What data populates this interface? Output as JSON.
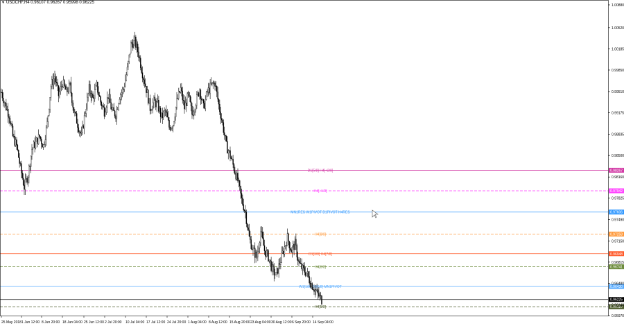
{
  "header": {
    "symbol_label": "USDCHF,H4",
    "ohlc_label": "0.96107 0.96267 0.95998 0.96225",
    "menu_icon": "triangle-down-icon"
  },
  "colors": {
    "background": "#ffffff",
    "axis": "#000000",
    "candle": "#000000"
  },
  "chart_data": {
    "type": "candlestick",
    "title": "",
    "xlabel": "",
    "ylabel": "",
    "ylim": [
      0.9597,
      1.0088
    ],
    "y_ticks": [
      "1.00880",
      "1.00520",
      "1.00185",
      "0.99850",
      "0.99510",
      "0.99175",
      "0.98835",
      "0.98500",
      "0.98160",
      "0.97825",
      "0.97490",
      "0.97150",
      "0.96815",
      "0.96480",
      "0.96140",
      "0.95970"
    ],
    "x_ticks": [
      "25 May 2018",
      "1 Jun 12:00",
      "8 Jun 20:00",
      "18 Jun 04:00",
      "25 Jun 12:00",
      "2 Jul 20:00",
      "10 Jul 04:00",
      "17 Jul 12:00",
      "24 Jul 20:00",
      "1 Aug 04:00",
      "8 Aug 12:00",
      "15 Aug 20:00",
      "23 Aug 04:00",
      "30 Aug 12:00",
      "6 Sep 20:00",
      "14 Sep 04:00"
    ],
    "close_path": [
      [
        0,
        0.995
      ],
      [
        4,
        0.993
      ],
      [
        8,
        0.9915
      ],
      [
        12,
        0.988
      ],
      [
        16,
        0.9865
      ],
      [
        20,
        0.983
      ],
      [
        24,
        0.98
      ],
      [
        28,
        0.982
      ],
      [
        32,
        0.986
      ],
      [
        36,
        0.987
      ],
      [
        40,
        0.988
      ],
      [
        44,
        0.9865
      ],
      [
        48,
        0.99
      ],
      [
        52,
        0.996
      ],
      [
        56,
        0.9975
      ],
      [
        60,
        0.9945
      ],
      [
        64,
        0.9965
      ],
      [
        68,
        0.995
      ],
      [
        72,
        0.996
      ],
      [
        76,
        0.992
      ],
      [
        80,
        0.99
      ],
      [
        84,
        0.988
      ],
      [
        88,
        0.992
      ],
      [
        92,
        0.9955
      ],
      [
        96,
        0.994
      ],
      [
        100,
        0.996
      ],
      [
        104,
        0.9935
      ],
      [
        108,
        0.992
      ],
      [
        112,
        0.9945
      ],
      [
        116,
        0.992
      ],
      [
        120,
        0.9915
      ],
      [
        124,
        0.9945
      ],
      [
        128,
        0.9955
      ],
      [
        132,
        0.9985
      ],
      [
        136,
        1.0025
      ],
      [
        140,
        1.003
      ],
      [
        144,
        1.001
      ],
      [
        148,
        0.998
      ],
      [
        152,
        0.9955
      ],
      [
        156,
        0.9925
      ],
      [
        160,
        0.9935
      ],
      [
        164,
        0.993
      ],
      [
        168,
        0.991
      ],
      [
        172,
        0.992
      ],
      [
        176,
        0.9895
      ],
      [
        180,
        0.99
      ],
      [
        184,
        0.9935
      ],
      [
        188,
        0.9955
      ],
      [
        192,
        0.9925
      ],
      [
        196,
        0.9945
      ],
      [
        200,
        0.9915
      ],
      [
        204,
        0.9935
      ],
      [
        208,
        0.9955
      ],
      [
        212,
        0.9925
      ],
      [
        216,
        0.995
      ],
      [
        220,
        0.996
      ],
      [
        224,
        0.9965
      ],
      [
        228,
        0.993
      ],
      [
        232,
        0.99
      ],
      [
        236,
        0.9865
      ],
      [
        240,
        0.985
      ],
      [
        244,
        0.983
      ],
      [
        248,
        0.981
      ],
      [
        252,
        0.978
      ],
      [
        256,
        0.976
      ],
      [
        260,
        0.972
      ],
      [
        264,
        0.97
      ],
      [
        268,
        0.969
      ],
      [
        272,
        0.973
      ],
      [
        276,
        0.97
      ],
      [
        280,
        0.969
      ],
      [
        284,
        0.967
      ],
      [
        288,
        0.966
      ],
      [
        292,
        0.968
      ],
      [
        296,
        0.97
      ],
      [
        300,
        0.972
      ],
      [
        304,
        0.97
      ],
      [
        308,
        0.971
      ],
      [
        312,
        0.968
      ],
      [
        316,
        0.967
      ],
      [
        320,
        0.9665
      ],
      [
        324,
        0.965
      ],
      [
        328,
        0.964
      ],
      [
        332,
        0.963
      ],
      [
        336,
        0.9622
      ]
    ],
    "levels": [
      {
        "price": 0.98267,
        "label": "D1[5/8] H4[+2/8]",
        "badge": "0.98267",
        "color": "#d23ba6",
        "dashed": false
      },
      {
        "price": 0.97942,
        "label": "H4[+1/8]",
        "badge": "0.97942",
        "color": "#ff44ff",
        "dashed": true
      },
      {
        "price": 0.97606,
        "label": "MN1RES W1PIVOT D1PIVOT H4RES",
        "badge": "0.97606",
        "color": "#3399ff",
        "dashed": false
      },
      {
        "price": 0.97258,
        "label": "H4[8/8]",
        "badge": "0.97258",
        "color": "#ff9a3c",
        "dashed": true
      },
      {
        "price": 0.96948,
        "label": "D1[3/8] H4[7/8]",
        "badge": "0.96948",
        "color": "#ff5a2a",
        "dashed": false
      },
      {
        "price": 0.96741,
        "label": "H4[6/8]",
        "badge": "0.96741",
        "color": "#6b8a3a",
        "dashed": true
      },
      {
        "price": 0.9643,
        "label": "W1[1/8] D1[2/8] MN1PIVOT",
        "badge": "0.96430",
        "color": "#55aaff",
        "dashed": false
      },
      {
        "price": 0.96225,
        "label": "",
        "badge": "0.96225",
        "color": "#000000",
        "dashed": false
      },
      {
        "price": 0.9611,
        "label": "H4[5/8]",
        "badge": "0.96110",
        "color": "#4a5a2a",
        "dashed": true
      }
    ]
  }
}
